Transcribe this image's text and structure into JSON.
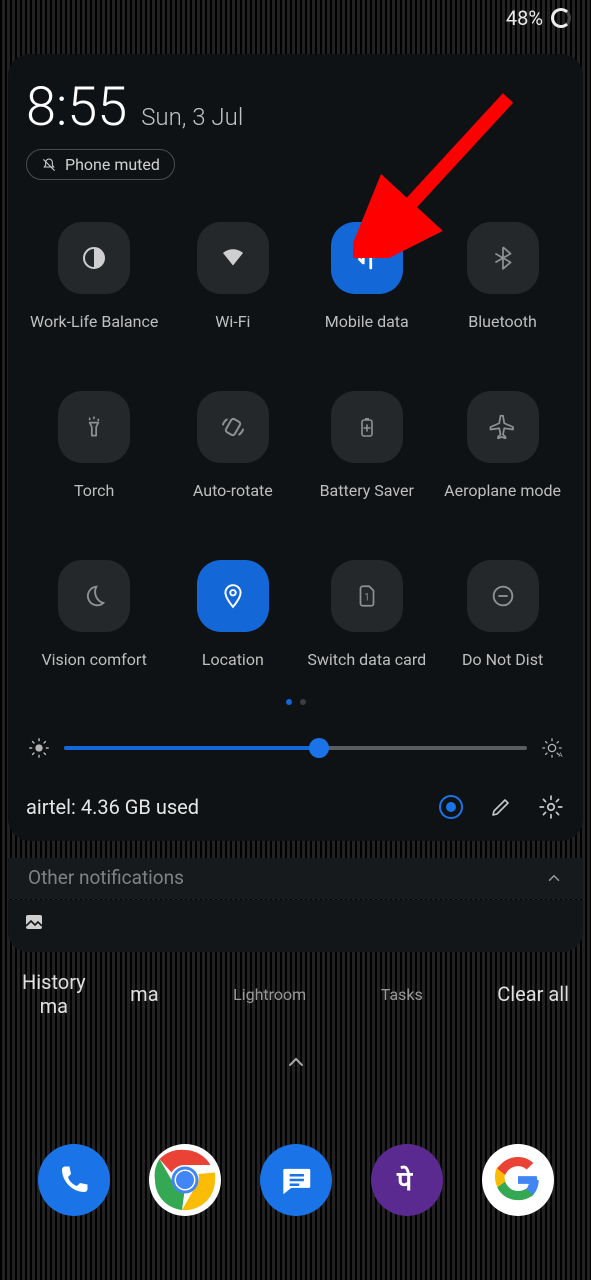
{
  "statusbar": {
    "battery": "48%"
  },
  "header": {
    "time": "8:55",
    "date": "Sun, 3 Jul",
    "muted_label": "Phone muted"
  },
  "tiles": [
    {
      "label": "Work-Life Balance",
      "icon": "balance-icon",
      "active": false
    },
    {
      "label": "Wi-Fi",
      "icon": "wifi-icon",
      "active": false
    },
    {
      "label": "Mobile data",
      "icon": "mobile-data-icon",
      "active": true
    },
    {
      "label": "Bluetooth",
      "icon": "bluetooth-icon",
      "active": false
    },
    {
      "label": "Torch",
      "icon": "torch-icon",
      "active": false
    },
    {
      "label": "Auto-rotate",
      "icon": "auto-rotate-icon",
      "active": false
    },
    {
      "label": "Battery Saver",
      "icon": "battery-saver-icon",
      "active": false
    },
    {
      "label": "Aeroplane mode",
      "icon": "airplane-icon",
      "active": false
    },
    {
      "label": "Vision comfort",
      "icon": "moon-icon",
      "active": false
    },
    {
      "label": "Location",
      "icon": "location-icon",
      "active": true
    },
    {
      "label": "Switch data card",
      "icon": "sim-icon",
      "active": false
    },
    {
      "label": "Do Not Dist",
      "icon": "dnd-icon",
      "active": false
    }
  ],
  "brightness": {
    "percent": 55
  },
  "footer": {
    "usage": "airtel: 4.36 GB used"
  },
  "notifications": {
    "other_label": "Other notifications"
  },
  "recents": {
    "history": "History",
    "clear_all": "Clear all",
    "apps": [
      "ma",
      "Lightroom",
      "Tasks"
    ],
    "extra_label_top": "ma"
  },
  "dock": [
    "Phone",
    "Chrome",
    "Messages",
    "PhonePe",
    "Google"
  ]
}
